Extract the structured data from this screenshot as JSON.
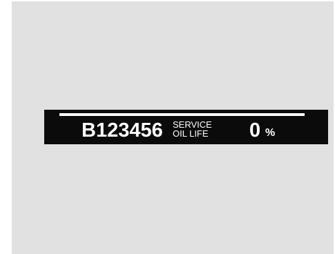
{
  "display": {
    "odometer": "B123456",
    "service_line_1": "SERVICE",
    "service_line_2": "OIL LIFE",
    "oil_life_value": "0",
    "oil_life_unit": "%",
    "life_bar_fraction": 1.0
  },
  "colors": {
    "panel_background": "#e1e1e2",
    "display_background": "#0b0b0b",
    "display_text": "#ffffff"
  }
}
